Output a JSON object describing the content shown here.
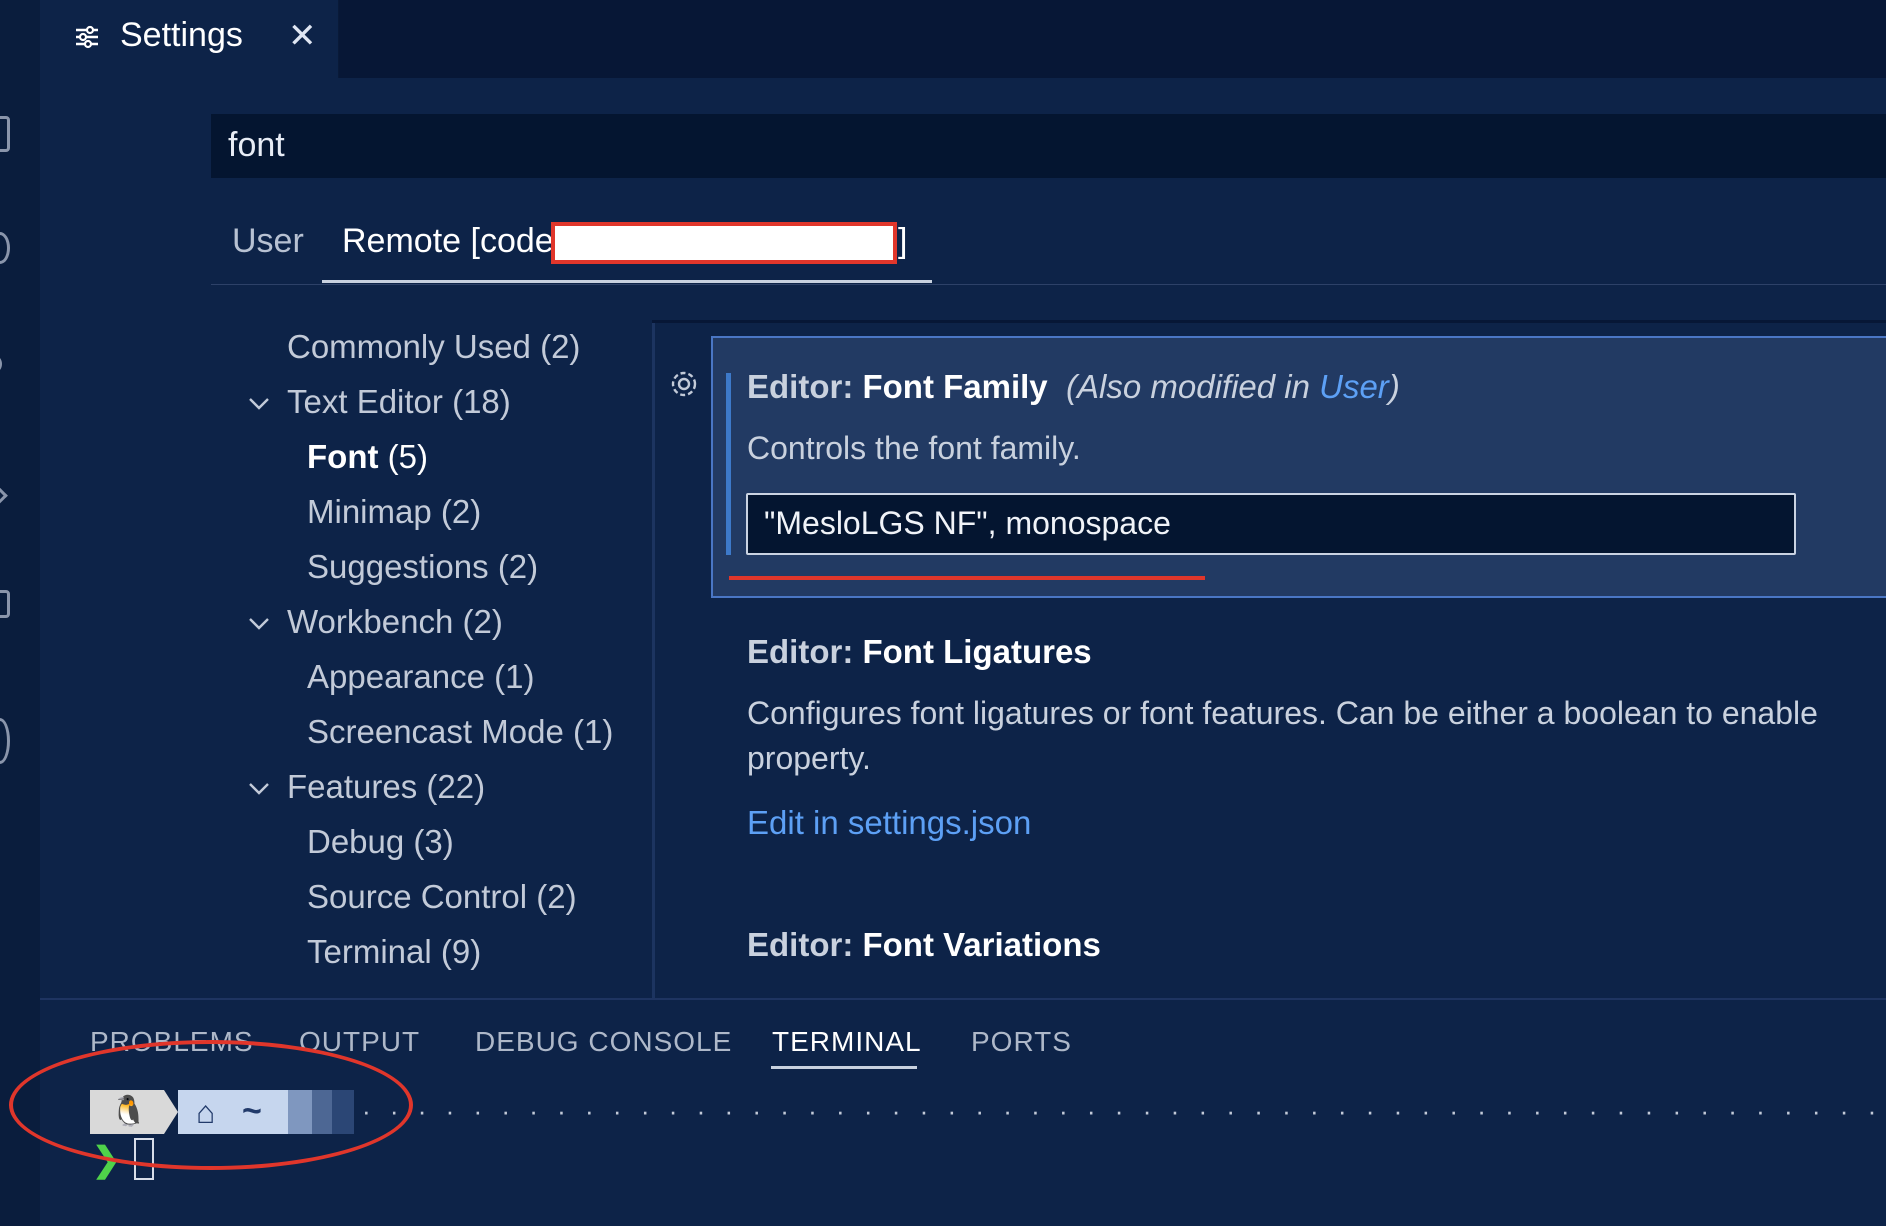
{
  "tab": {
    "title": "Settings",
    "close": "✕"
  },
  "search": {
    "value": "font"
  },
  "scopes": {
    "user": "User",
    "remote": "Remote [code",
    "remote_end": "]"
  },
  "toc": [
    {
      "label": "Commonly Used",
      "count": "(2)"
    },
    {
      "label": "Text Editor",
      "count": "(18)"
    },
    {
      "label": "Font",
      "count": "(5)"
    },
    {
      "label": "Minimap",
      "count": "(2)"
    },
    {
      "label": "Suggestions",
      "count": "(2)"
    },
    {
      "label": "Workbench",
      "count": "(2)"
    },
    {
      "label": "Appearance",
      "count": "(1)"
    },
    {
      "label": "Screencast Mode",
      "count": "(1)"
    },
    {
      "label": "Features",
      "count": "(22)"
    },
    {
      "label": "Debug",
      "count": "(3)"
    },
    {
      "label": "Source Control",
      "count": "(2)"
    },
    {
      "label": "Terminal",
      "count": "(9)"
    }
  ],
  "settings": {
    "font_family": {
      "category": "Editor: ",
      "name": "Font Family",
      "note_pre": "(Also modified in ",
      "note_link": "User",
      "note_post": ")",
      "description": "Controls the font family.",
      "value": "\"MesloLGS NF\",  monospace"
    },
    "font_ligatures": {
      "category": "Editor: ",
      "name": "Font Ligatures",
      "description_line1": "Configures font ligatures or font features. Can be either a boolean to enable",
      "description_line2": "property.",
      "link": "Edit in settings.json"
    },
    "font_variations": {
      "category": "Editor: ",
      "name": "Font Variations"
    }
  },
  "panel": {
    "tabs": [
      "PROBLEMS",
      "OUTPUT",
      "DEBUG CONSOLE",
      "TERMINAL",
      "PORTS"
    ],
    "active_tab": "TERMINAL"
  },
  "terminal": {
    "dir": "~",
    "prompt_char": "❯",
    "dots": "· · · · · · · · · · · · · · · · · · · · · · · · · · · · · · · · · · · · · · · · · · · · · · · · · · · · · · · ·"
  },
  "colors": {
    "accent_link": "#5da0f5",
    "highlight": "#e0362b",
    "prompt_green": "#4fd24a"
  }
}
